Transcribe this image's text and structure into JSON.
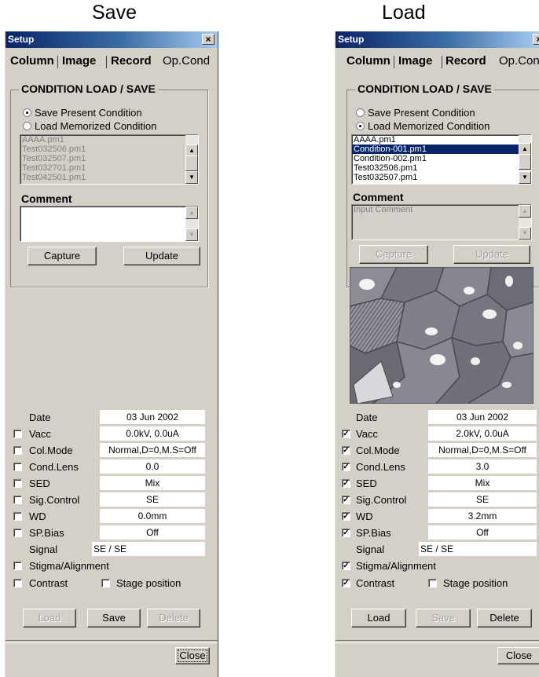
{
  "captions": {
    "save": "Save",
    "load": "Load"
  },
  "panels": {
    "save": {
      "window_title": "Setup",
      "close_x": "×",
      "tabs": [
        "Column",
        "Image",
        "Record",
        "Op.Cond"
      ],
      "group_title": "CONDITION LOAD / SAVE",
      "radio_save": "Save Present Condition",
      "radio_load": "Load Memorized Condition",
      "selected_radio": "save",
      "list_items": [
        "AAAA.pm1",
        "Test032506.pm1",
        "Test032507.pm1",
        "Test032701.pm1",
        "Test042501.pm1"
      ],
      "comment_label": "Comment",
      "comment_text": "",
      "capture_btn": "Capture",
      "update_btn": "Update",
      "date_label": "Date",
      "date_value": "03 Jun 2002",
      "rows": [
        {
          "label": "Vacc",
          "value": "0.0kV, 0.0uA",
          "checked": false
        },
        {
          "label": "Col.Mode",
          "value": "Normal,D=0,M.S=Off",
          "checked": false
        },
        {
          "label": "Cond.Lens",
          "value": "0.0",
          "checked": false
        },
        {
          "label": "SED",
          "value": "Mix",
          "checked": false
        },
        {
          "label": "Sig.Control",
          "value": "SE",
          "checked": false
        },
        {
          "label": "WD",
          "value": "0.0mm",
          "checked": false
        },
        {
          "label": "SP.Bias",
          "value": "Off",
          "checked": false
        }
      ],
      "signal_label": "Signal",
      "signal_value": "SE / SE",
      "stigma_label": "Stigma/Alignment",
      "stigma_checked": false,
      "contrast_label": "Contrast",
      "contrast_checked": false,
      "stage_label": "Stage position",
      "stage_checked": false,
      "load_btn": "Load",
      "save_btn": "Save",
      "delete_btn": "Delete",
      "close_btn": "Close"
    },
    "load": {
      "window_title": "Setup",
      "close_x": "×",
      "tabs": [
        "Column",
        "Image",
        "Record",
        "Op.Cond"
      ],
      "group_title": "CONDITION LOAD / SAVE",
      "radio_save": "Save Present Condition",
      "radio_load": "Load Memorized Condition",
      "selected_radio": "load",
      "list_items": [
        "AAAA.pm1",
        "Condition-001.pm1",
        "Condition-002.pm1",
        "Test032506.pm1",
        "Test032507.pm1"
      ],
      "selected_item": "Condition-001.pm1",
      "comment_label": "Comment",
      "comment_text": "Input Comment",
      "capture_btn": "Capture",
      "update_btn": "Update",
      "date_label": "Date",
      "date_value": "03 Jun 2002",
      "rows": [
        {
          "label": "Vacc",
          "value": "2.0kV, 0.0uA",
          "checked": true
        },
        {
          "label": "Col.Mode",
          "value": "Normal,D=0,M.S=Off",
          "checked": true
        },
        {
          "label": "Cond.Lens",
          "value": "3.0",
          "checked": true
        },
        {
          "label": "SED",
          "value": "Mix",
          "checked": true
        },
        {
          "label": "Sig.Control",
          "value": "SE",
          "checked": true
        },
        {
          "label": "WD",
          "value": "3.2mm",
          "checked": true
        },
        {
          "label": "SP.Bias",
          "value": "Off",
          "checked": true
        }
      ],
      "signal_label": "Signal",
      "signal_value": "SE / SE",
      "stigma_label": "Stigma/Alignment",
      "stigma_checked": true,
      "contrast_label": "Contrast",
      "contrast_checked": true,
      "stage_label": "Stage position",
      "stage_checked": false,
      "load_btn": "Load",
      "save_btn": "Save",
      "delete_btn": "Delete",
      "close_btn": "Close"
    }
  }
}
